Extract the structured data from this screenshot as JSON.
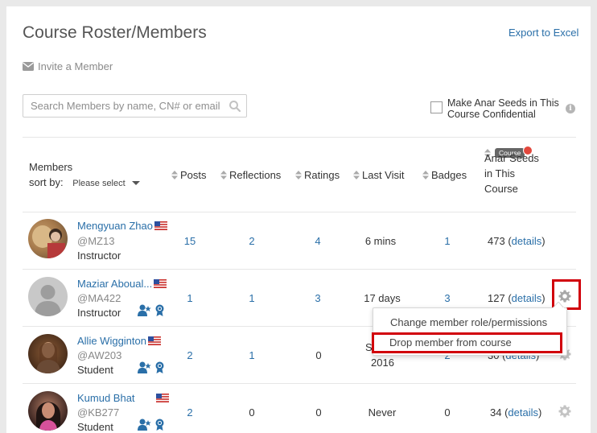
{
  "header": {
    "title": "Course Roster/Members",
    "export_label": "Export to Excel",
    "invite_label": "Invite a Member"
  },
  "search": {
    "placeholder": "Search Members by name, CN# or email"
  },
  "confidential": {
    "label_line1": "Make Anar Seeds in This",
    "label_line2": "Course Confidential",
    "checked": false,
    "info_glyph": "i"
  },
  "columns": {
    "members": "Members",
    "sort_by": "sort by:",
    "sort_select": "Please select",
    "posts": "Posts",
    "reflections": "Reflections",
    "ratings": "Ratings",
    "last_visit": "Last Visit",
    "badges": "Badges",
    "course_badge": "Course",
    "seeds_line1": "Anar Seeds",
    "seeds_line2": "in This",
    "seeds_line3": "Course"
  },
  "members": [
    {
      "name": "Mengyuan Zhao",
      "handle": "@MZ13",
      "role": "Instructor",
      "posts": "15",
      "reflections": "2",
      "ratings": "4",
      "last_visit": "6 mins",
      "badges": "1",
      "seeds": "473",
      "details_label": "details"
    },
    {
      "name": "Maziar Aboual...",
      "handle": "@MA422",
      "role": "Instructor",
      "posts": "1",
      "reflections": "1",
      "ratings": "3",
      "last_visit": "17 days",
      "badges": "3",
      "seeds": "127",
      "details_label": "details"
    },
    {
      "name": "Allie Wigginton",
      "handle": "@AW203",
      "role": "Student",
      "posts": "2",
      "reflections": "1",
      "ratings": "0",
      "last_visit_line1": "S",
      "last_visit_line2": "2016",
      "badges": "2",
      "seeds": "30",
      "details_label": "details"
    },
    {
      "name": "Kumud Bhat",
      "handle": "@KB277",
      "role": "Student",
      "posts": "2",
      "reflections": "0",
      "ratings": "0",
      "last_visit": "Never",
      "badges": "0",
      "seeds": "34",
      "details_label": "details"
    }
  ],
  "menu": {
    "change_role": "Change member role/permissions",
    "drop_member": "Drop member from course"
  },
  "colors": {
    "link": "#2a6fa8",
    "highlight_red": "#d1000b"
  }
}
